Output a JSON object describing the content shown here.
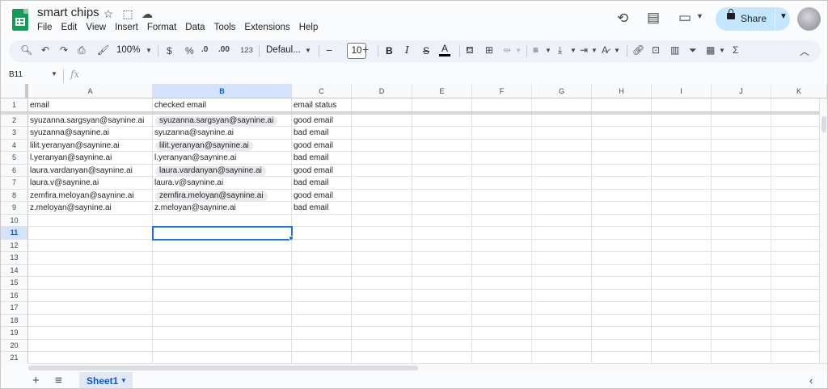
{
  "document": {
    "title": "smart chips"
  },
  "title_icons": [
    "star-icon",
    "move-to-folder-icon",
    "cloud-status-icon"
  ],
  "menu": [
    "File",
    "Edit",
    "View",
    "Insert",
    "Format",
    "Data",
    "Tools",
    "Extensions",
    "Help"
  ],
  "header_actions": {
    "share_label": "Share"
  },
  "toolbar": {
    "zoom": "100%",
    "currency": "$",
    "percent": "%",
    "dec_decrease": ".0",
    "dec_increase": ".00",
    "number_format": "123",
    "font": "Defaul...",
    "font_size": "10",
    "bold": "B",
    "italic": "I",
    "strike": "S",
    "text_color": "A",
    "function": "Σ"
  },
  "formula_bar": {
    "name_box": "B11",
    "fx": "fx"
  },
  "columns": [
    "A",
    "B",
    "C",
    "D",
    "E",
    "F",
    "G",
    "H",
    "I",
    "J",
    "K"
  ],
  "selected_column": "B",
  "selected_row": "11",
  "rows": [
    "1",
    "2",
    "3",
    "4",
    "5",
    "6",
    "7",
    "8",
    "9",
    "10",
    "11",
    "12",
    "13",
    "14",
    "15",
    "16",
    "17",
    "18",
    "19",
    "20",
    "21"
  ],
  "cells": {
    "r1": {
      "a": "email",
      "b": "checked email",
      "c": "email status"
    },
    "r2": {
      "a": "syuzanna.sargsyan@saynine.ai",
      "b": "syuzanna.sargsyan@saynine.ai",
      "c": "good email"
    },
    "r3": {
      "a": "syuzanna@saynine.ai",
      "b": "syuzanna@saynine.ai",
      "c": "bad email"
    },
    "r4": {
      "a": "lilit.yeranyan@saynine.ai",
      "b": "lilit.yeranyan@saynine.ai",
      "c": "good email"
    },
    "r5": {
      "a": "l.yeranyan@saynine.ai",
      "b": "l.yeranyan@saynine.ai",
      "c": "bad email"
    },
    "r6": {
      "a": "laura.vardanyan@saynine.ai",
      "b": "laura.vardanyan@saynine.ai",
      "c": "good email"
    },
    "r7": {
      "a": "laura.v@saynine.ai",
      "b": "laura.v@saynine.ai",
      "c": "bad email"
    },
    "r8": {
      "a": "zemfira.meloyan@saynine.ai",
      "b": "zemfira.meloyan@saynine.ai",
      "c": "good email"
    },
    "r9": {
      "a": "z.meloyan@saynine.ai",
      "b": "z.meloyan@saynine.ai",
      "c": "bad email"
    }
  },
  "sheets": {
    "active": "Sheet1"
  }
}
